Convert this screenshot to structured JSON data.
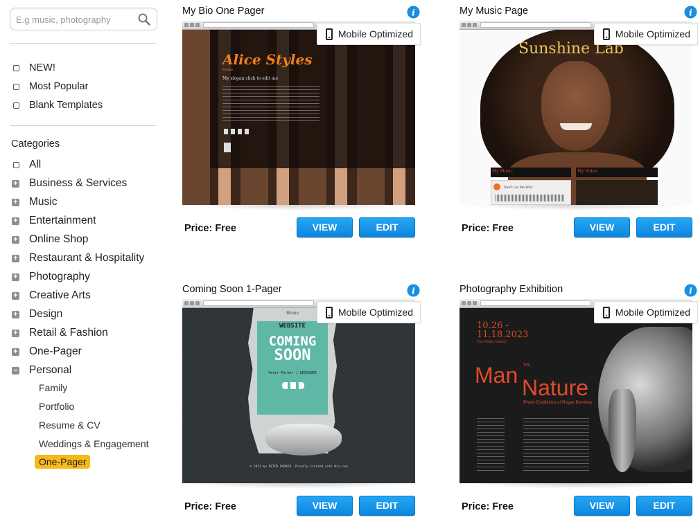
{
  "search": {
    "placeholder": "E.g music, photography"
  },
  "filters": [
    {
      "label": "NEW!"
    },
    {
      "label": "Most Popular"
    },
    {
      "label": "Blank Templates"
    }
  ],
  "categories_title": "Categories",
  "categories": [
    {
      "label": "All",
      "kind": "checkbox"
    },
    {
      "label": "Business & Services",
      "kind": "plus"
    },
    {
      "label": "Music",
      "kind": "plus"
    },
    {
      "label": "Entertainment",
      "kind": "plus"
    },
    {
      "label": "Online Shop",
      "kind": "plus"
    },
    {
      "label": "Restaurant & Hospitality",
      "kind": "plus"
    },
    {
      "label": "Photography",
      "kind": "plus"
    },
    {
      "label": "Creative Arts",
      "kind": "plus"
    },
    {
      "label": "Design",
      "kind": "plus"
    },
    {
      "label": "Retail & Fashion",
      "kind": "plus"
    },
    {
      "label": "One-Pager",
      "kind": "plus"
    },
    {
      "label": "Personal",
      "kind": "minus"
    }
  ],
  "personal_subcategories": [
    {
      "label": "Family"
    },
    {
      "label": "Portfolio"
    },
    {
      "label": "Resume & CV"
    },
    {
      "label": "Weddings & Engagement"
    },
    {
      "label": "One-Pager",
      "active": true
    }
  ],
  "mobile_badge": "Mobile Optimized",
  "templates": [
    {
      "title": "My Bio One Pager",
      "price": "Price: Free",
      "view_label": "VIEW",
      "edit_label": "EDIT",
      "preview": {
        "name": "Alice Styles",
        "tag": "Home",
        "slogan": "My slogan click to edit me",
        "url": "netcraz.com"
      }
    },
    {
      "title": "My Music Page",
      "price": "Price: Free",
      "view_label": "VIEW",
      "edit_label": "EDIT",
      "preview": {
        "name": "Sunshine Lab",
        "music_label": "My Music",
        "video_label": "My Video",
        "track": "Don't Let Me Wait",
        "url": "netcraz.com"
      }
    },
    {
      "title": "Coming Soon 1-Pager",
      "price": "Price: Free",
      "view_label": "VIEW",
      "edit_label": "EDIT",
      "preview": {
        "home": "Home",
        "website": "WEBSITE",
        "coming": "COMING",
        "soon": "SOON",
        "person": "Peter Parker | DESIGNER",
        "footer": "© 2023 by PETER PARKER. Proudly created with Wix.com",
        "url": "netcraz.com"
      }
    },
    {
      "title": "Photography Exhibition",
      "price": "Price: Free",
      "view_label": "VIEW",
      "edit_label": "EDIT",
      "preview": {
        "dates": "10.26 -\n11.18.2023",
        "gallery": "The Wilder Gallery",
        "man": "Man",
        "vs": "VS",
        "nature": "Nature",
        "subtitle": "Photo Exhibition of Roger Brentley",
        "url": "netcraz.com"
      }
    }
  ],
  "colors": {
    "button": "#1294e6",
    "active_tag": "#f6b81a",
    "alice_name": "#f07f1a",
    "sunshine": "#e9c763",
    "coming_soon_teal": "#5fb8a6",
    "exhibition_red": "#e2492b"
  }
}
